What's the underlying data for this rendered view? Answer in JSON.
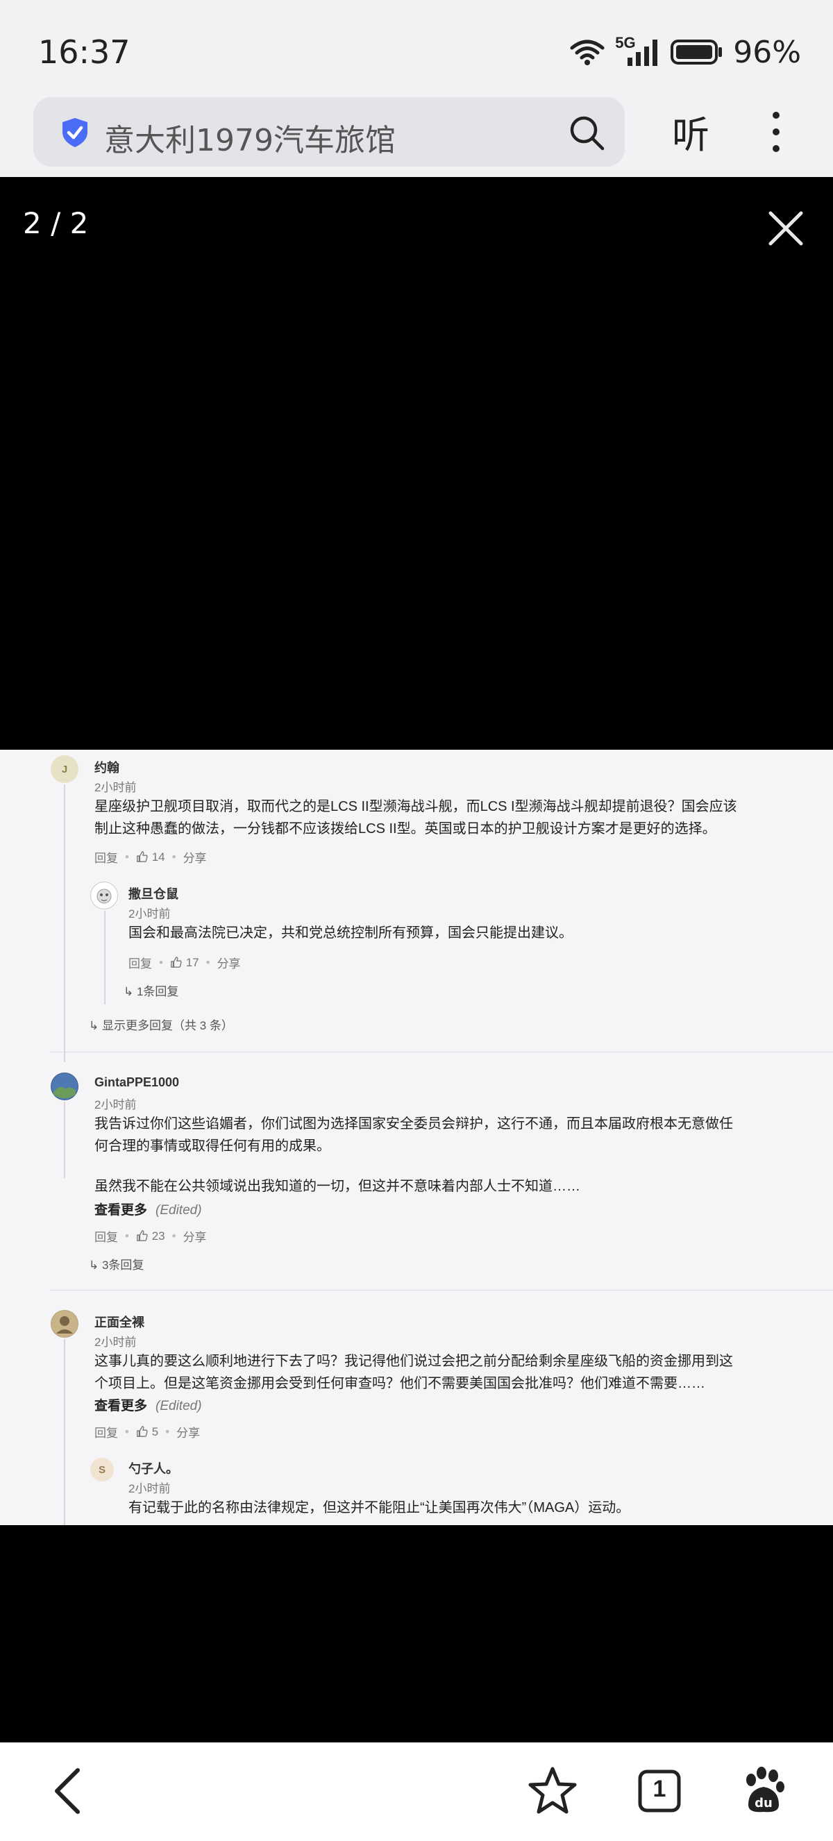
{
  "status_bar": {
    "time": "16:37",
    "network": "5G",
    "battery": "96%"
  },
  "browser": {
    "url_text": "意大利1979汽车旅馆",
    "listen_label": "听",
    "icons": [
      "shield-icon",
      "search-icon",
      "more-vert-icon"
    ]
  },
  "viewer": {
    "counter": "2 / 2",
    "close_icon": "close-icon"
  },
  "comments": [
    {
      "avatar_letter": "J",
      "author": "约翰",
      "time": "2小时前",
      "text_lines": [
        "星座级护卫舰项目取消，取而代之的是LCS II型濒海战斗舰，而LCS I型濒海战斗舰却提前退役？国会应该",
        "制止这种愚蠢的做法，一分钱都不应该拨给LCS II型。英国或日本的护卫舰设计方案才是更好的选择。"
      ],
      "reply": "回复",
      "likes": "14",
      "share": "分享",
      "replies": [
        {
          "author": "撒旦仓鼠",
          "time": "2小时前",
          "text": "国会和最高法院已决定，共和党总统控制所有预算，国会只能提出建议。",
          "reply": "回复",
          "likes": "17",
          "share": "分享",
          "reply_count": "1条回复"
        }
      ],
      "show_more": "显示更多回复（共 3 条）"
    },
    {
      "author": "GintaPPE1000",
      "time": "2小时前",
      "text_lines": [
        "我告诉过你们这些谄媚者，你们试图为选择国家安全委员会辩护，这行不通，而且本届政府根本无意做任",
        "何合理的事情或取得任何有用的成果。",
        "",
        "虽然我不能在公共领域说出我知道的一切，但这并不意味着内部人士不知道……"
      ],
      "see_more": "查看更多",
      "edited": "(Edited)",
      "reply": "回复",
      "likes": "23",
      "share": "分享",
      "reply_count": "3条回复"
    },
    {
      "author": "正面全裸",
      "time": "2小时前",
      "text_lines": [
        "这事儿真的要这么顺利地进行下去了吗？我记得他们说过会把之前分配给剩余星座级飞船的资金挪用到这",
        "个项目上。但是这笔资金挪用会受到任何审查吗？他们不需要美国国会批准吗？他们难道不需要……"
      ],
      "see_more": "查看更多",
      "edited": "(Edited)",
      "reply": "回复",
      "likes": "5",
      "share": "分享",
      "replies": [
        {
          "avatar_letter": "S",
          "author": "勺子人。",
          "time": "2小时前",
          "text": "有记载于此的名称由法律规定，但这并不能阻止“让美国再次伟大”（MAGA）运动。"
        }
      ]
    }
  ],
  "bottom_nav": {
    "tab_count": "1",
    "icons": [
      "back-icon",
      "star-icon",
      "tabs-icon",
      "baidu-paw-icon"
    ]
  }
}
